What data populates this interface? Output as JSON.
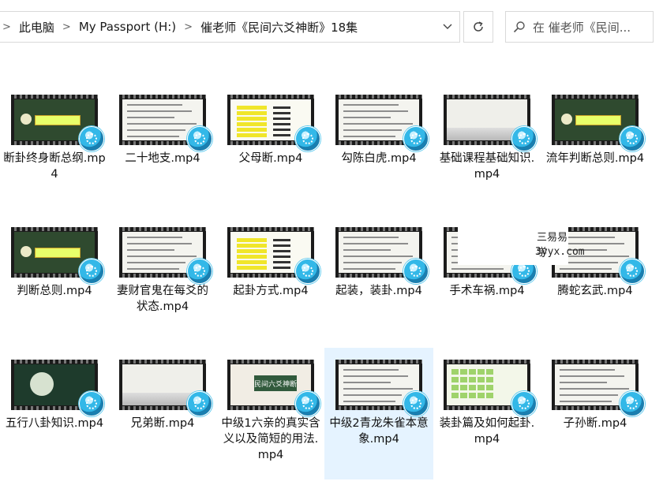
{
  "addressbar": {
    "breadcrumbs": [
      "此电脑",
      "My Passport (H:)",
      "催老师《民间六爻神断》18集"
    ],
    "separator": ">"
  },
  "search": {
    "placeholder": "在 催老师《民间..."
  },
  "watermark": {
    "line1": "三易易学",
    "line2": "3yyx.com"
  },
  "files": [
    {
      "name": "断卦终身断总纲.mp4",
      "thumb": "green"
    },
    {
      "name": "二十地支.mp4",
      "thumb": "paper"
    },
    {
      "name": "父母断.mp4",
      "thumb": "yellow"
    },
    {
      "name": "勾陈白虎.mp4",
      "thumb": "paper"
    },
    {
      "name": "基础课程基础知识.mp4",
      "thumb": "ink"
    },
    {
      "name": "流年判断总则.mp4",
      "thumb": "green"
    },
    {
      "name": "判断总则.mp4",
      "thumb": "green"
    },
    {
      "name": "妻财官鬼在每爻的状态.mp4",
      "thumb": "paper"
    },
    {
      "name": "起卦方式.mp4",
      "thumb": "yellow"
    },
    {
      "name": "起装，装卦.mp4",
      "thumb": "paper"
    },
    {
      "name": "手术车祸.mp4",
      "thumb": "paper"
    },
    {
      "name": "腾蛇玄武.mp4",
      "thumb": "paper"
    },
    {
      "name": "五行八卦知识.mp4",
      "thumb": "dark"
    },
    {
      "name": "兄弟断.mp4",
      "thumb": "ink"
    },
    {
      "name": "中级1六亲的真实含义以及简短的用法.mp4",
      "thumb": "title"
    },
    {
      "name": "中级2青龙朱雀本意象.mp4",
      "thumb": "paper",
      "state": "hovered"
    },
    {
      "name": "装卦篇及如何起卦.mp4",
      "thumb": "table"
    },
    {
      "name": "子孙断.mp4",
      "thumb": "paper"
    }
  ],
  "thumb_caption": "民间六爻神断",
  "colors": {
    "selection": "#e5f3ff",
    "accent": "#33b8e8"
  }
}
